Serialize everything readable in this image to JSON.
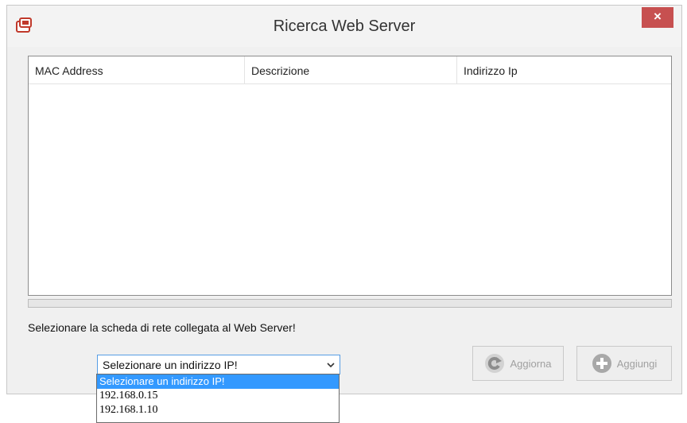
{
  "window": {
    "title": "Ricerca Web Server",
    "close_label": "×"
  },
  "table": {
    "columns": [
      "MAC Address",
      "Descrizione",
      "Indirizzo Ip"
    ],
    "rows": []
  },
  "progress": {
    "fraction": 0
  },
  "instruction": "Selezionare la scheda di rete collegata al Web Server!",
  "combo": {
    "selected": "Selezionare un indirizzo IP!",
    "options": [
      "Selezionare un indirizzo IP!",
      "192.168.0.15",
      "192.168.1.10"
    ]
  },
  "buttons": {
    "refresh": {
      "label": "Aggiorna",
      "icon": "refresh-icon",
      "enabled": false
    },
    "add": {
      "label": "Aggiungi",
      "icon": "plus-circle-icon",
      "enabled": false
    }
  },
  "colors": {
    "close_button": "#c75050",
    "selection": "#3399ff",
    "combo_border": "#569de5"
  }
}
